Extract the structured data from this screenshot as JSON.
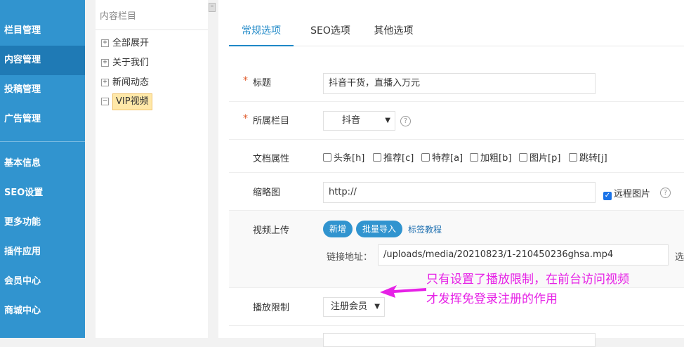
{
  "sidebar": {
    "items": [
      {
        "label": "栏目管理"
      },
      {
        "label": "内容管理"
      },
      {
        "label": "投稿管理"
      },
      {
        "label": "广告管理"
      },
      {
        "label": "基本信息"
      },
      {
        "label": "SEO设置"
      },
      {
        "label": "更多功能"
      },
      {
        "label": "插件应用"
      },
      {
        "label": "会员中心"
      },
      {
        "label": "商城中心"
      }
    ],
    "active": "内容管理"
  },
  "tree": {
    "title": "内容栏目",
    "nodes": [
      {
        "toggle": "+",
        "label": "全部展开"
      },
      {
        "toggle": "+",
        "label": "关于我们"
      },
      {
        "toggle": "+",
        "label": "新闻动态"
      },
      {
        "toggle": "–",
        "label": "VIP视频"
      }
    ],
    "collapse_symbol": "–"
  },
  "tabs": [
    {
      "label": "常规选项"
    },
    {
      "label": "SEO选项"
    },
    {
      "label": "其他选项"
    }
  ],
  "form": {
    "title": {
      "required": "*",
      "label": "标题",
      "value": "抖音干货，直播入万元"
    },
    "category": {
      "required": "*",
      "label": "所属栏目",
      "value": "抖音",
      "help": "?"
    },
    "attrs": {
      "label": "文档属性",
      "options": [
        "头条[h]",
        "推荐[c]",
        "特荐[a]",
        "加粗[b]",
        "图片[p]",
        "跳转[j]"
      ]
    },
    "thumbnail": {
      "label": "缩略图",
      "value": "http://",
      "remote_label": "远程图片",
      "remote_checked": true,
      "help": "?"
    },
    "video": {
      "label": "视频上传",
      "add_button": "新增",
      "import_button": "批量导入",
      "tutorial_link": "标签教程",
      "link_label": "链接地址：",
      "link_value": "/uploads/media/20210823/1-210450236ghsa.mp4",
      "trailing": "选"
    },
    "play_limit": {
      "label": "播放限制",
      "value": "注册会员"
    }
  },
  "annotation": {
    "line1": "只有设置了播放限制，在前台访问视频",
    "line2": "才发挥免登录注册的作用",
    "color": "#e621e6"
  }
}
